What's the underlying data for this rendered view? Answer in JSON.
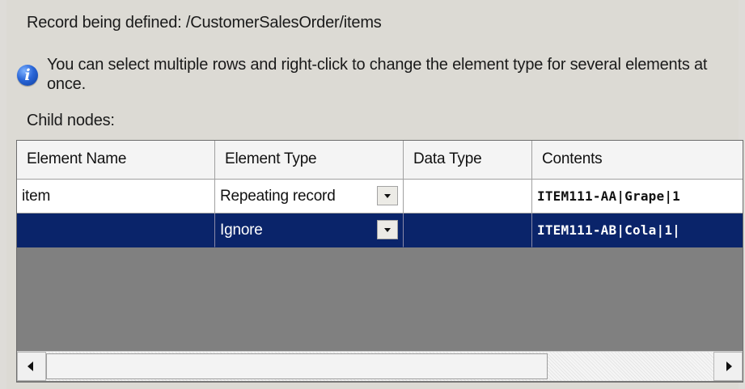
{
  "record": {
    "label": "Record being defined: /CustomerSalesOrder/items"
  },
  "info": {
    "icon": "info-icon",
    "message": "You can select multiple rows and right-click to change the element type for several elements at once."
  },
  "child_nodes_label": "Child nodes:",
  "table": {
    "columns": [
      "Element Name",
      "Element Type",
      "Data Type",
      "Contents"
    ],
    "rows": [
      {
        "element_name": "item",
        "element_type": "Repeating record",
        "data_type": "",
        "contents": "ITEM111-AA|Grape|1"
      },
      {
        "element_name": "",
        "element_type": "Ignore",
        "data_type": "",
        "contents": "ITEM111-AB|Cola|1|"
      }
    ]
  },
  "colors": {
    "selected_row": "#0a246a",
    "panel_background": "#dcdad4",
    "grid_empty_area": "#808080"
  }
}
